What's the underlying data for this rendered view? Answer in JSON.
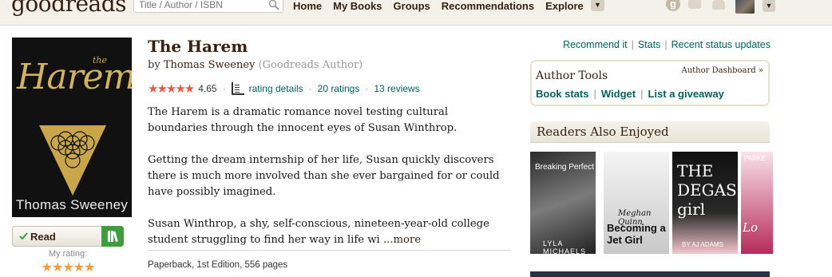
{
  "nav": {
    "logo": "goodreads",
    "search_placeholder": "Title / Author / ISBN",
    "links": [
      "Home",
      "My Books",
      "Groups",
      "Recommendations",
      "Explore"
    ],
    "menu_caret": "▼",
    "notifications_icon_letter": "g"
  },
  "book": {
    "title": "The Harem",
    "by_label": "by",
    "author": "Thomas Sweeney",
    "author_badge": "(Goodreads Author)",
    "stars": "★★★★★",
    "avg_rating": "4.65",
    "rating_details": "rating details",
    "ratings_count": "20 ratings",
    "reviews_count": "13 reviews",
    "description": [
      "The Harem is a dramatic romance novel testing cultural boundaries through the innocent eyes of Susan Winthrop.",
      "Getting the dream internship of her life, Susan quickly discovers there is much more involved than she ever bargained for or could have possibly imagined.",
      "Susan Winthrop, a shy, self-conscious, nineteen-year-old college student struggling to find her way in life wi"
    ],
    "more_link": "...more",
    "format": "Paperback, 1st Edition, 556 pages"
  },
  "cover": {
    "small_word": "the",
    "title_word": "Harem",
    "author": "Thomas Sweeney"
  },
  "shelf": {
    "read_label": "Read",
    "my_rating_label": "My rating:",
    "my_stars": "★★★★★"
  },
  "sidebar": {
    "top_links": [
      "Recommend it",
      "Stats",
      "Recent status updates"
    ],
    "author_tools_title": "Author Tools",
    "author_dashboard": "Author Dashboard »",
    "author_tool_links": [
      "Book stats",
      "Widget",
      "List a giveaway"
    ],
    "readers_also_enjoyed": "Readers Also Enjoyed"
  },
  "also_enjoyed": [
    {
      "title_text": "Breaking Perfect",
      "author_text": "LYLA MICHAELS"
    },
    {
      "title_text": "Becoming a Jet Girl",
      "author_text": "Meghan Quinn"
    },
    {
      "title_text": "THE DEGAS girl",
      "author_text": "BY AJ ADAMS"
    },
    {
      "title_text": "Lo",
      "author_text": "PARKE"
    }
  ],
  "colors": {
    "brand_bg": "#f4f1ea",
    "brand_dark": "#382110",
    "link_green": "#00635d",
    "star_red": "#e85d42",
    "star_orange": "#f29d37",
    "shelf_green": "#409d3e"
  }
}
